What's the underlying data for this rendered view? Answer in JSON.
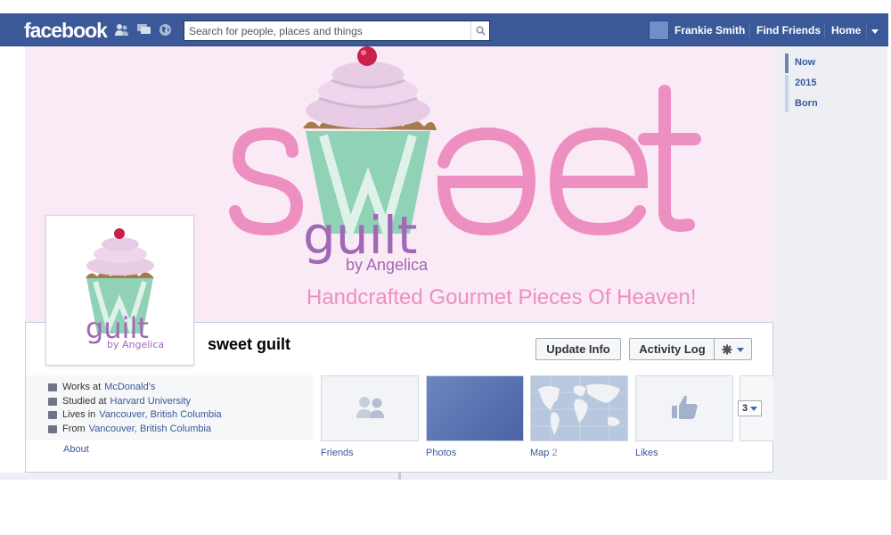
{
  "header": {
    "logo": "facebook",
    "search_placeholder": "Search for people, places and things",
    "user_name": "Frankie Smith",
    "find_friends": "Find Friends",
    "home": "Home"
  },
  "cover": {
    "brand_word": "sweet",
    "brand_sub": "guilt",
    "brand_by": "by Angelica",
    "tagline": "Handcrafted Gourmet Pieces Of Heaven!"
  },
  "profile": {
    "name": "sweet guilt",
    "pic_brand": "guilt",
    "pic_by": "by Angelica",
    "update_info": "Update Info",
    "activity_log": "Activity Log"
  },
  "info": {
    "works_prefix": "Works at",
    "works_link": "McDonald's",
    "studied_prefix": "Studied at",
    "studied_link": "Harvard University",
    "lives_prefix": "Lives in",
    "lives_link": "Vancouver, British Columbia",
    "from_prefix": "From",
    "from_link": "Vancouver, British Columbia",
    "about": "About"
  },
  "tiles": {
    "friends": "Friends",
    "photos": "Photos",
    "map": "Map",
    "map_count": "2",
    "likes": "Likes",
    "more_count": "3"
  },
  "timeline": [
    "Now",
    "2015",
    "Born"
  ],
  "colors": {
    "fb_blue": "#3b5998",
    "cover_pink": "#f9eaf6",
    "sweet_pink": "#ee8fc1",
    "guilt_purple": "#a168b5",
    "cup_green": "#8fd2b5",
    "frosting": "#e8cce6",
    "cherry": "#c9214a"
  }
}
